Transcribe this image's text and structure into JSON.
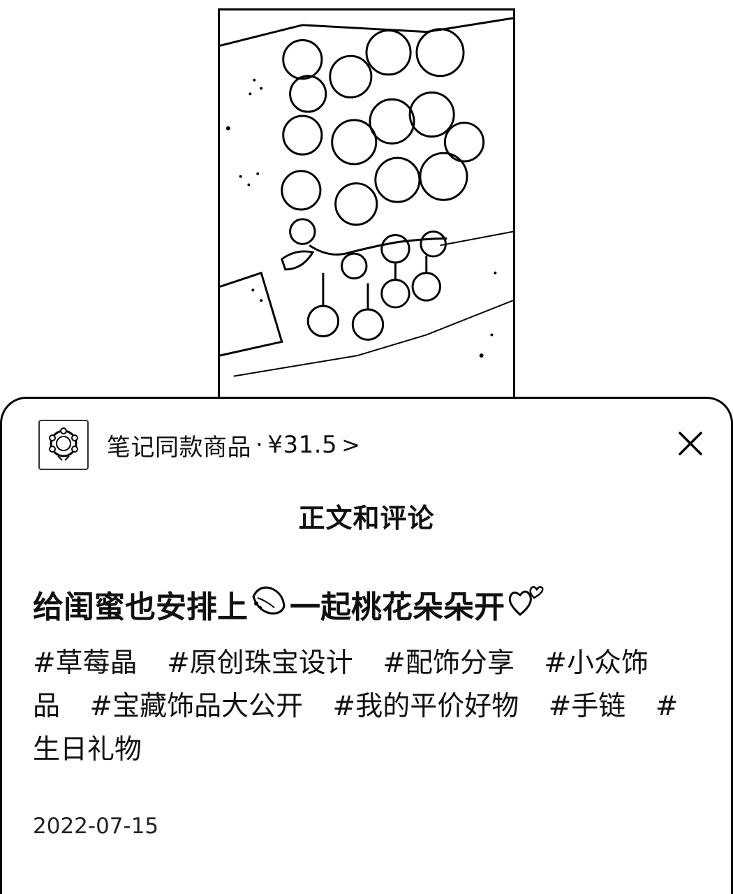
{
  "product": {
    "label": "笔记同款商品",
    "separator": "·",
    "price": "¥31.5",
    "chevron": ">",
    "thumb_icon": "bracelet-thumbnail"
  },
  "section_title": "正文和评论",
  "post": {
    "title_part1": "给闺蜜也安排上",
    "emoji1": "peach-icon",
    "title_part2": "一起桃花朵朵开",
    "emoji2": "hearts-icon",
    "tags": [
      "#草莓晶",
      "#原创珠宝设计",
      "#配饰分享",
      "#小众饰品",
      "#宝藏饰品大公开",
      "#我的平价好物",
      "#手链",
      "#生日礼物"
    ],
    "date": "2022-07-15"
  },
  "icons": {
    "close": "close-icon"
  }
}
